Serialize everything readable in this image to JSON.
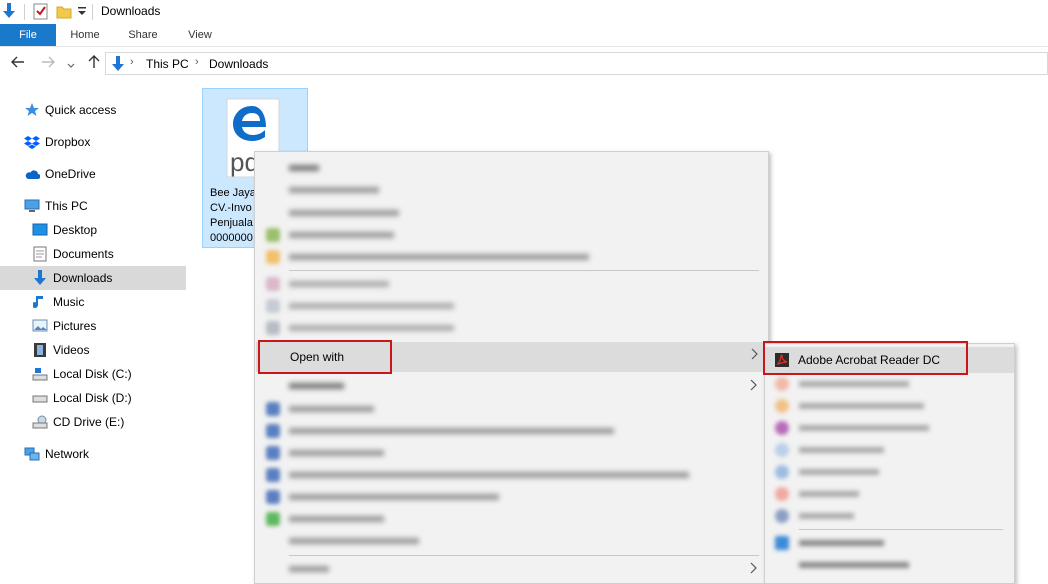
{
  "titlebar": {
    "title": "Downloads"
  },
  "ribbon": {
    "tabs": [
      "File",
      "Home",
      "Share",
      "View"
    ]
  },
  "address": {
    "crumbs": [
      "This PC",
      "Downloads"
    ]
  },
  "nav": {
    "items": [
      {
        "label": "Quick access",
        "icon": "star-icon"
      },
      {
        "label": "Dropbox",
        "icon": "dropbox-icon"
      },
      {
        "label": "OneDrive",
        "icon": "cloud-icon"
      },
      {
        "label": "This PC",
        "icon": "computer-icon"
      },
      {
        "label": "Desktop",
        "icon": "desktop-icon"
      },
      {
        "label": "Documents",
        "icon": "documents-icon"
      },
      {
        "label": "Downloads",
        "icon": "download-arrow-icon"
      },
      {
        "label": "Music",
        "icon": "music-note-icon"
      },
      {
        "label": "Pictures",
        "icon": "pictures-icon"
      },
      {
        "label": "Videos",
        "icon": "videos-icon"
      },
      {
        "label": "Local Disk (C:)",
        "icon": "drive-icon"
      },
      {
        "label": "Local Disk (D:)",
        "icon": "drive-icon"
      },
      {
        "label": "CD Drive (E:)",
        "icon": "cd-drive-icon"
      },
      {
        "label": "Network",
        "icon": "network-icon"
      }
    ]
  },
  "file": {
    "icon_letters": "pdf",
    "name_lines": [
      "Bee Jaya",
      "CV.-Invo",
      "Penjuala",
      "0000000"
    ]
  },
  "context_menu": {
    "open_with_label": "Open with"
  },
  "submenu": {
    "acrobat_label": "Adobe Acrobat Reader DC"
  },
  "colors": {
    "accent": "#1979ca",
    "highlight_box": "#c9161b",
    "selection": "#cce8ff"
  }
}
